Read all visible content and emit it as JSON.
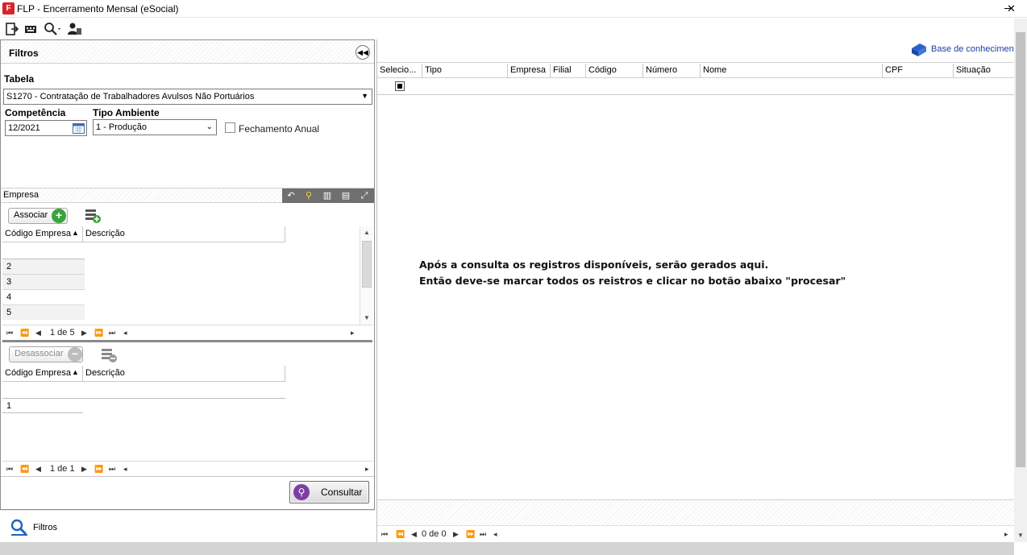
{
  "window": {
    "title": "FLP - Encerramento Mensal (eSocial)",
    "close_glyph": "✕"
  },
  "filters": {
    "title": "Filtros",
    "tabela_label": "Tabela",
    "tabela_value": "S1270 - Contratação de Trabalhadores Avulsos Não Portuários",
    "competencia_label": "Competência",
    "competencia_value": "12/2021",
    "tipo_ambiente_label": "Tipo Ambiente",
    "tipo_ambiente_value": "1 - Produção",
    "fechamento_anual_label": "Fechamento Anual",
    "fechamento_anual_checked": false
  },
  "empresa": {
    "title": "Empresa",
    "associar_label": "Associar",
    "desassociar_label": "Desassociar",
    "available_grid": {
      "columns": [
        "Código Empresa",
        "Descrição"
      ],
      "rows": [
        "",
        "2",
        "3",
        "4",
        "5"
      ],
      "pager_text": "1 de 5"
    },
    "associated_grid": {
      "columns": [
        "Código Empresa",
        "Descrição"
      ],
      "rows": [
        "",
        "1"
      ],
      "pager_text": "1 de 1"
    }
  },
  "consultar_label": "Consultar",
  "bottom_filtros_label": "Filtros",
  "results": {
    "knowledge_base_link": "Base de conhecimento",
    "columns": [
      "Selecio...",
      "Tipo",
      "Empresa",
      "Filial",
      "Código",
      "Número",
      "Nome",
      "CPF",
      "Situação"
    ],
    "message_line1": "Após a consulta os registros disponíveis, serão gerados aqui.",
    "message_line2": "Então deve-se marcar todos os reistros e clicar no botão abaixo \"procesar\"",
    "pager_text": "0 de 0"
  },
  "colors": {
    "accent_purple": "#7b3fa6",
    "link_blue": "#1b3fa3",
    "add_green": "#3aa43a",
    "app_red": "#d8232a"
  }
}
